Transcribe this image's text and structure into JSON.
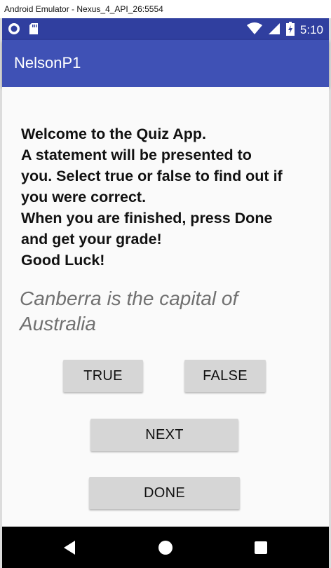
{
  "window": {
    "title": "Android Emulator - Nexus_4_API_26:5554"
  },
  "status_bar": {
    "time": "5:10",
    "left_icons": [
      "circle-notification-icon",
      "sd-card-icon"
    ],
    "right_icons": [
      "wifi-icon",
      "cell-signal-icon",
      "battery-charging-icon"
    ],
    "color": "#303f9f"
  },
  "app_bar": {
    "title": "NelsonP1",
    "color": "#3f51b5"
  },
  "main": {
    "welcome_lines": [
      "Welcome to the Quiz App.",
      "A statement will be presented to",
      "you. Select true or false to find out if",
      "you were correct.",
      "When you are finished, press Done",
      "and get your grade!",
      "Good Luck!"
    ],
    "question": "Canberra is the capital of Australia",
    "buttons": {
      "true_label": "TRUE",
      "false_label": "FALSE",
      "next_label": "NEXT",
      "done_label": "DONE"
    }
  },
  "nav_bar": {
    "icons": [
      "back-icon",
      "home-icon",
      "recent-apps-icon"
    ]
  }
}
